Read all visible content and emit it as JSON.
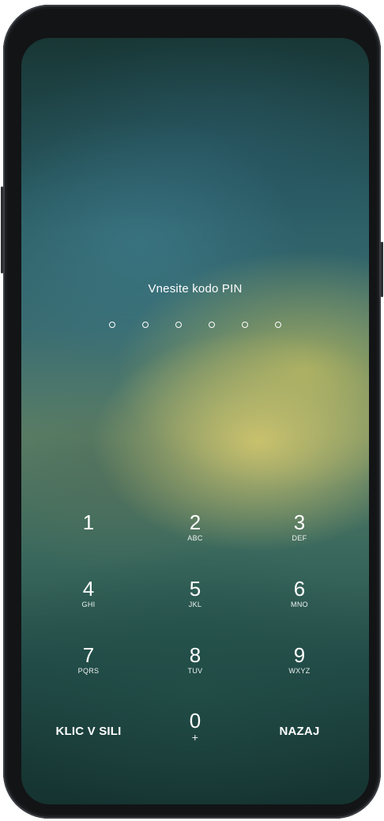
{
  "lock_screen": {
    "prompt": "Vnesite kodo PIN",
    "pin_length": 6
  },
  "keypad": {
    "keys": [
      {
        "digit": "1",
        "letters": ""
      },
      {
        "digit": "2",
        "letters": "ABC"
      },
      {
        "digit": "3",
        "letters": "DEF"
      },
      {
        "digit": "4",
        "letters": "GHI"
      },
      {
        "digit": "5",
        "letters": "JKL"
      },
      {
        "digit": "6",
        "letters": "MNO"
      },
      {
        "digit": "7",
        "letters": "PQRS"
      },
      {
        "digit": "8",
        "letters": "TUV"
      },
      {
        "digit": "9",
        "letters": "WXYZ"
      },
      {
        "digit": "0",
        "letters": "+"
      }
    ],
    "emergency_label": "KLIC V SILI",
    "back_label": "NAZAJ"
  }
}
